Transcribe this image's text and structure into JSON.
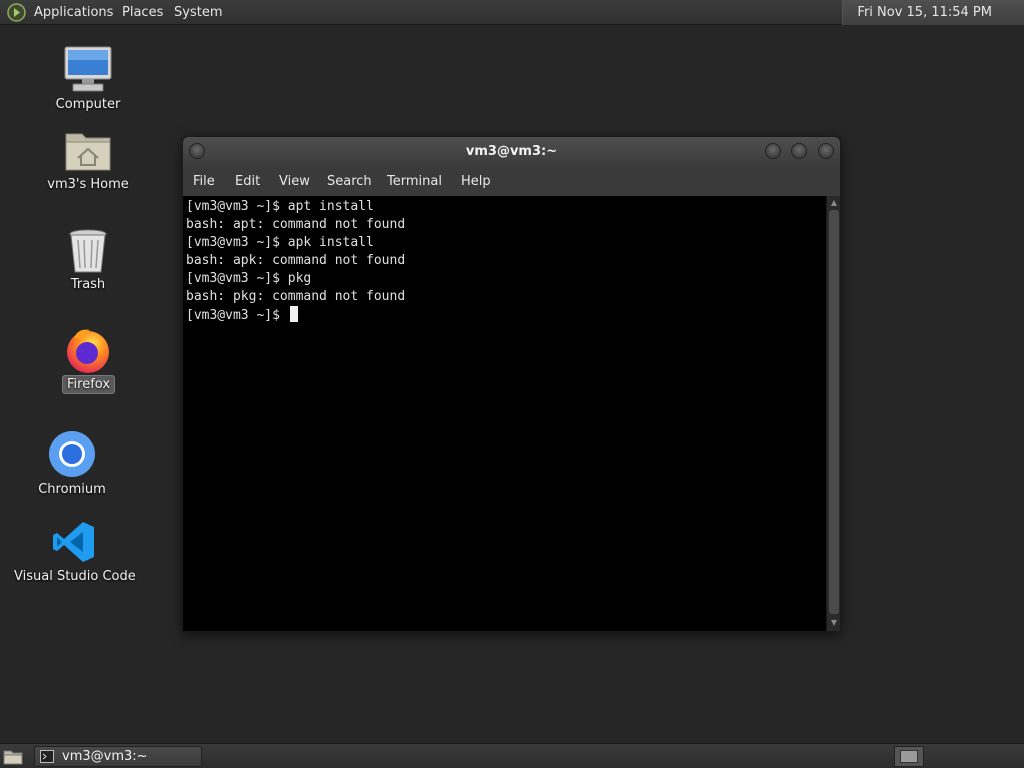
{
  "top_panel": {
    "menus": [
      "Applications",
      "Places",
      "System"
    ],
    "clock": "Fri Nov 15, 11:54 PM"
  },
  "desktop_icons": [
    {
      "label": "Computer",
      "icon": "computer-icon"
    },
    {
      "label": "vm3's Home",
      "icon": "home-folder-icon"
    },
    {
      "label": "Trash",
      "icon": "trash-icon"
    },
    {
      "label": "Firefox",
      "icon": "firefox-icon",
      "selected": true
    },
    {
      "label": "Chromium",
      "icon": "chromium-icon"
    },
    {
      "label": "Visual Studio Code",
      "icon": "vscode-icon"
    }
  ],
  "terminal": {
    "title": "vm3@vm3:~",
    "menu": [
      "File",
      "Edit",
      "View",
      "Search",
      "Terminal",
      "Help"
    ],
    "lines": [
      "[vm3@vm3 ~]$ apt install",
      "bash: apt: command not found",
      "[vm3@vm3 ~]$ apk install",
      "bash: apk: command not found",
      "[vm3@vm3 ~]$ pkg",
      "bash: pkg: command not found"
    ],
    "prompt": "[vm3@vm3 ~]$ "
  },
  "taskbar": {
    "items": [
      {
        "label": "vm3@vm3:~",
        "icon": "terminal-icon"
      }
    ]
  },
  "colors": {
    "desktop_bg": "#262626",
    "terminal_bg": "#000000",
    "panel_bg": "#333333"
  }
}
